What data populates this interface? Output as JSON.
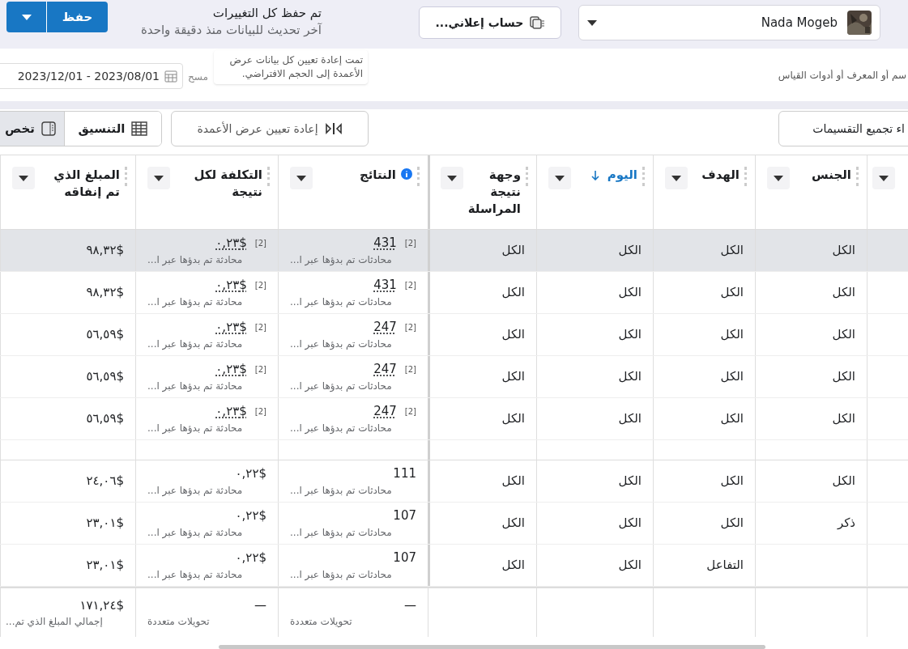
{
  "top_bar": {
    "account": {
      "name": "Nada Mogeb"
    },
    "ad_account_button": "حساب إعلاني...",
    "status": {
      "title": "تم حفظ كل التغييرات",
      "subtitle": "آخر تحديث للبيانات منذ دقيقة واحدة"
    },
    "save_button": "حفظ"
  },
  "filter_bar": {
    "search": {
      "placeholder": "سم أو المعرف أو أدوات القياس"
    },
    "date_range": "2023/12/01 - 2023/08/01",
    "clear": "مسح",
    "toast": "تمت إعادة تعيين كل بيانات عرض الأعمدة إلى الحجم الافتراضي."
  },
  "toolbar": {
    "breakdown_button": "اء تجميع التقسيمات",
    "reset_columns_button": "إعادة تعيين عرض الأعمدة",
    "format_button": "التنسيق",
    "customize_button": "تخص"
  },
  "table": {
    "columns": [
      {},
      {
        "label": "الجنس"
      },
      {
        "label": "الهدف"
      },
      {
        "label": "اليوم",
        "sorted": true
      },
      {
        "label": "وجهة نتيجة المراسلة"
      },
      {
        "label": "النتائج",
        "info": true
      },
      {
        "label": "التكلفة لكل نتيجة"
      },
      {
        "label": "المبلغ الذي تم إنفاقه"
      }
    ],
    "groups": [
      {
        "rows": [
          {
            "selected": true,
            "gender": "الكل",
            "objective": "الكل",
            "day": "الكل",
            "destination": "الكل",
            "results": {
              "value": "431",
              "footnote": "[2]",
              "label": "محادثات تم بدؤها عبر ا..."
            },
            "cost": {
              "value": "٠,٢٣$",
              "footnote": "[2]",
              "label": "محادثة تم بدؤها عبر ا..."
            },
            "spent": "٩٨,٣٢$"
          },
          {
            "selected": false,
            "gender": "الكل",
            "objective": "الكل",
            "day": "الكل",
            "destination": "الكل",
            "results": {
              "value": "431",
              "footnote": "[2]",
              "label": "محادثات تم بدؤها عبر ا..."
            },
            "cost": {
              "value": "٠,٢٣$",
              "footnote": "[2]",
              "label": "محادثة تم بدؤها عبر ا..."
            },
            "spent": "٩٨,٣٢$"
          },
          {
            "selected": false,
            "gender": "الكل",
            "objective": "الكل",
            "day": "الكل",
            "destination": "الكل",
            "results": {
              "value": "247",
              "footnote": "[2]",
              "label": "محادثات تم بدؤها عبر ا..."
            },
            "cost": {
              "value": "٠,٢٣$",
              "footnote": "[2]",
              "label": "محادثة تم بدؤها عبر ا..."
            },
            "spent": "٥٦,٥٩$"
          },
          {
            "selected": false,
            "gender": "الكل",
            "objective": "الكل",
            "day": "الكل",
            "destination": "الكل",
            "results": {
              "value": "247",
              "footnote": "[2]",
              "label": "محادثات تم بدؤها عبر ا..."
            },
            "cost": {
              "value": "٠,٢٣$",
              "footnote": "[2]",
              "label": "محادثة تم بدؤها عبر ا..."
            },
            "spent": "٥٦,٥٩$"
          },
          {
            "selected": false,
            "gender": "الكل",
            "objective": "الكل",
            "day": "الكل",
            "destination": "الكل",
            "results": {
              "value": "247",
              "footnote": "[2]",
              "label": "محادثات تم بدؤها عبر ا..."
            },
            "cost": {
              "value": "٠,٢٣$",
              "footnote": "[2]",
              "label": "محادثة تم بدؤها عبر ا..."
            },
            "spent": "٥٦,٥٩$"
          }
        ]
      },
      {
        "rows": [
          {
            "selected": false,
            "gender": "الكل",
            "objective": "الكل",
            "day": "الكل",
            "destination": "الكل",
            "results": {
              "value": "111",
              "label": "محادثات تم بدؤها عبر ا..."
            },
            "cost": {
              "value": "٠,٢٢$",
              "label": "محادثة تم بدؤها عبر ا..."
            },
            "spent": "٢٤,٠٦$"
          },
          {
            "selected": false,
            "gender": "ذكر",
            "objective": "الكل",
            "day": "الكل",
            "destination": "الكل",
            "results": {
              "value": "107",
              "label": "محادثات تم بدؤها عبر ا..."
            },
            "cost": {
              "value": "٠,٢٢$",
              "label": "محادثة تم بدؤها عبر ا..."
            },
            "spent": "٢٣,٠١$"
          },
          {
            "selected": false,
            "objective": "التفاعل",
            "day": "الكل",
            "destination": "الكل",
            "results": {
              "value": "107",
              "label": "محادثات تم بدؤها عبر ا..."
            },
            "cost": {
              "value": "٠,٢٢$",
              "label": "محادثة تم بدؤها عبر ا..."
            },
            "spent": "٢٣,٠١$"
          }
        ]
      }
    ],
    "totals": {
      "results": {
        "value": "—",
        "label": "تحويلات متعددة"
      },
      "cost": {
        "value": "—",
        "label": "تحويلات متعددة"
      },
      "spent": {
        "value": "١٧١,٢٤$",
        "label": "إجمالي المبلغ الذي تم..."
      }
    }
  }
}
